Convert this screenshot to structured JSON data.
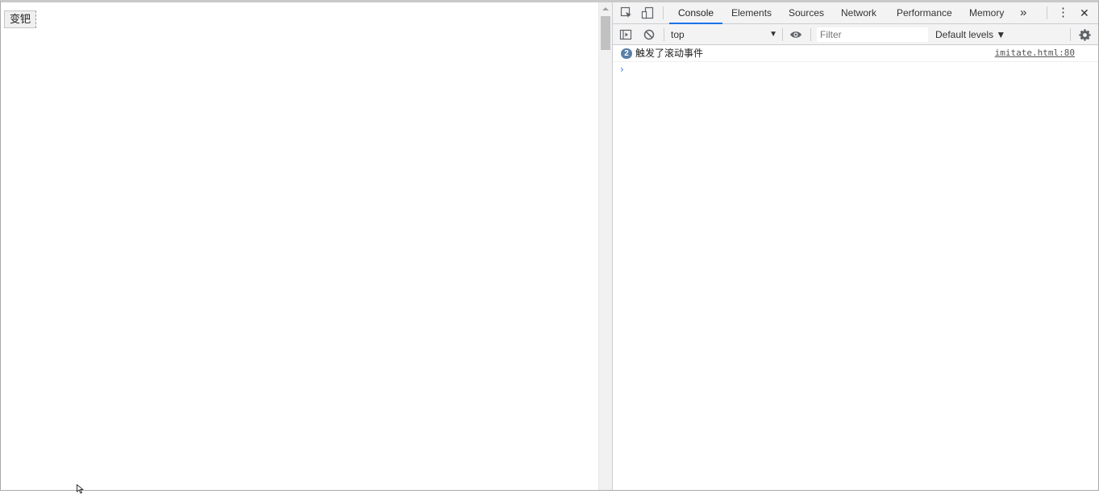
{
  "page": {
    "button_label": "变钯"
  },
  "devtools": {
    "tabs": [
      {
        "label": "Console",
        "active": true
      },
      {
        "label": "Elements",
        "active": false
      },
      {
        "label": "Sources",
        "active": false
      },
      {
        "label": "Network",
        "active": false
      },
      {
        "label": "Performance",
        "active": false
      },
      {
        "label": "Memory",
        "active": false
      }
    ],
    "more_tabs_glyph": "»",
    "menu_glyph": "⋮",
    "close_glyph": "✕",
    "toolbar": {
      "context": "top",
      "context_arrow": "▼",
      "filter_placeholder": "Filter",
      "levels": "Default levels ▼"
    },
    "console": {
      "messages": [
        {
          "count": "2",
          "text": "触发了滚动事件",
          "source": "imitate.html:80"
        }
      ],
      "prompt": "›"
    },
    "accent_color": "#1a73e8",
    "badge_color": "#5a7fa8"
  }
}
